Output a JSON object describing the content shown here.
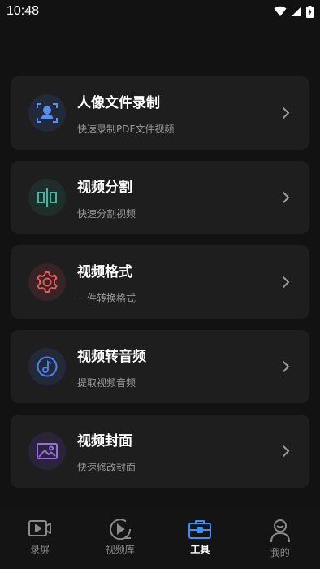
{
  "status_bar": {
    "time": "10:48"
  },
  "tools": [
    {
      "title": "人像文件录制",
      "subtitle": "快速录制PDF文件视频",
      "icon": "portrait-scan-icon",
      "color": "#5b8def",
      "bg": "#22293a"
    },
    {
      "title": "视频分割",
      "subtitle": "快速分割视频",
      "icon": "split-icon",
      "color": "#3fb8a0",
      "bg": "#1f2e2b"
    },
    {
      "title": "视频格式",
      "subtitle": "一件转换格式",
      "icon": "gear-icon",
      "color": "#e25a5a",
      "bg": "#382426"
    },
    {
      "title": "视频转音频",
      "subtitle": "提取视频音频",
      "icon": "music-note-icon",
      "color": "#4f7fe6",
      "bg": "#222a3a"
    },
    {
      "title": "视频封面",
      "subtitle": "快速修改封面",
      "icon": "image-icon",
      "color": "#9a6be0",
      "bg": "#2a243a"
    }
  ],
  "tab_bar": [
    {
      "label": "录屏",
      "icon": "record-screen-icon",
      "active": false
    },
    {
      "label": "视频库",
      "icon": "video-library-icon",
      "active": false
    },
    {
      "label": "工具",
      "icon": "toolbox-icon",
      "active": true
    },
    {
      "label": "我的",
      "icon": "profile-icon",
      "active": false
    }
  ],
  "colors": {
    "active_tab": "#3d8ef5",
    "inactive_tab": "#8a8a8a"
  }
}
